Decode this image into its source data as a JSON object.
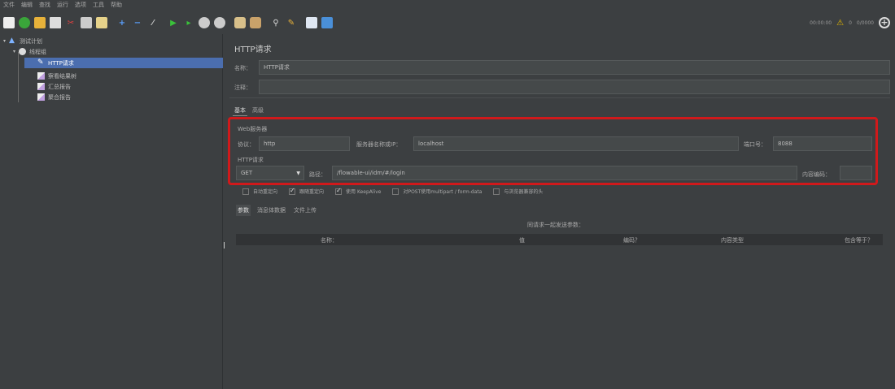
{
  "menubar": {
    "items": [
      "文件",
      "编辑",
      "查找",
      "运行",
      "选项",
      "工具",
      "帮助"
    ]
  },
  "toolbar": {
    "icons": [
      "new-file-icon",
      "open-template-icon",
      "open-folder-icon",
      "save-icon",
      "cut-icon",
      "copy-icon",
      "paste-icon",
      "expand-icon",
      "collapse-icon",
      "toggle-icon",
      "start-icon",
      "start-no-pause-icon",
      "stop-icon",
      "shutdown-icon",
      "clear-icon",
      "clear-all-icon",
      "search-icon",
      "reset-search-icon",
      "function-helper-icon",
      "help-icon"
    ],
    "timer": "00:00:00",
    "warning_count": "0",
    "thread_count": "0/0000"
  },
  "tree": {
    "test_plan": "测试计划",
    "thread_group": "线程组",
    "http_request": "HTTP请求",
    "result_tree": "察看结果树",
    "summary_report": "汇总报告",
    "aggregate_report": "聚合报告"
  },
  "panel": {
    "title": "HTTP请求",
    "name_label": "名称：",
    "name_value": "HTTP请求",
    "comment_label": "注释：",
    "comment_value": "",
    "tabs": [
      "基本",
      "高级"
    ],
    "web_server_label": "Web服务器",
    "protocol_label": "协议：",
    "protocol_value": "http",
    "server_label": "服务器名称或IP：",
    "server_value": "localhost",
    "port_label": "端口号：",
    "port_value": "8088",
    "http_request_label": "HTTP请求",
    "method_value": "GET",
    "path_label": "路径：",
    "path_value": "/flowable-ui/idm/#/login",
    "encoding_label": "内容编码：",
    "encoding_value": "",
    "checkboxes": [
      {
        "label": "自动重定向",
        "checked": false
      },
      {
        "label": "跟随重定向",
        "checked": true
      },
      {
        "label": "使用 KeepAlive",
        "checked": true
      },
      {
        "label": "对POST使用multipart / form-data",
        "checked": false
      },
      {
        "label": "与浏览器兼容的头",
        "checked": false
      }
    ],
    "subtabs": [
      "参数",
      "消息体数据",
      "文件上传"
    ],
    "table_title": "同请求一起发送参数：",
    "columns": [
      "名称：",
      "值",
      "编码？",
      "内容类型",
      "包含等于？"
    ]
  },
  "colors": {
    "accent_red": "#d0191b",
    "selection_blue": "#4b6eaf",
    "background": "#3c3f41"
  }
}
